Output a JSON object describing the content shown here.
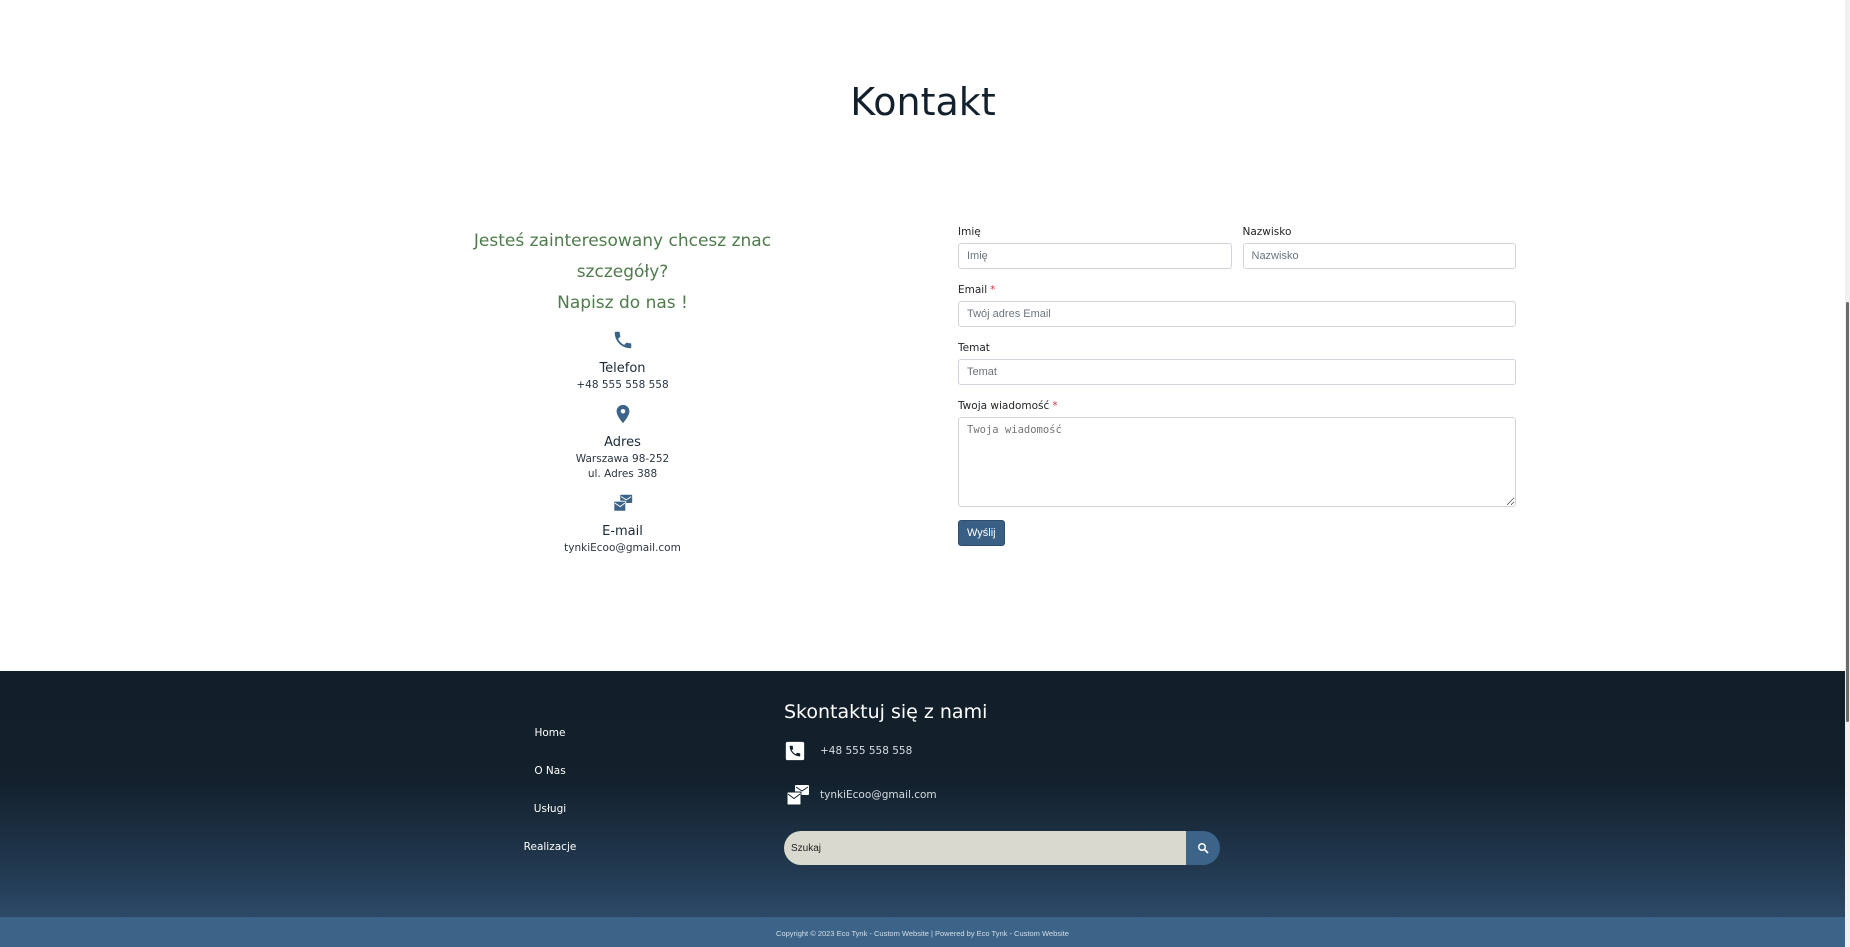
{
  "page": {
    "title": "Kontakt"
  },
  "info": {
    "headline_1": "Jesteś zainteresowany chcesz znac szczegóły?",
    "headline_2": "Napisz do nas !",
    "phone": {
      "icon": "phone-icon",
      "title": "Telefon",
      "value": "+48 555 558 558"
    },
    "address": {
      "icon": "map-pin-icon",
      "title": "Adres",
      "line_1": "Warszawa 98-252",
      "line_2": "ul. Adres 388"
    },
    "email": {
      "icon": "mail-bulk-icon",
      "title": "E-mail",
      "value": "tynkiEcoo@gmail.com"
    }
  },
  "form": {
    "first_name": {
      "label": "Imię",
      "placeholder": "Imię"
    },
    "last_name": {
      "label": "Nazwisko",
      "placeholder": "Nazwisko"
    },
    "email": {
      "label": "Email",
      "required_mark": "*",
      "placeholder": "Twój adres Email"
    },
    "subject": {
      "label": "Temat",
      "placeholder": "Temat"
    },
    "message": {
      "label": "Twoja wiadomość",
      "required_mark": "*",
      "placeholder": "Twoja wiadomość"
    },
    "submit_label": "Wyślij"
  },
  "footer": {
    "nav": [
      "Home",
      "O Nas",
      "Usługi",
      "Realizacje"
    ],
    "contact_heading": "Skontaktuj się z nami",
    "phone": "+48 555 558 558",
    "email": "tynkiEcoo@gmail.com",
    "search_placeholder": "Szukaj",
    "copyright": "Copyright © 2023 Eco Tynk - Custom Website | Powered by Eco Tynk - Custom Website"
  },
  "colors": {
    "accent": "#3b6488",
    "headline_green": "#4e7c4b",
    "footer_dark": "#121e28",
    "copyright_bar": "#3c6489"
  }
}
